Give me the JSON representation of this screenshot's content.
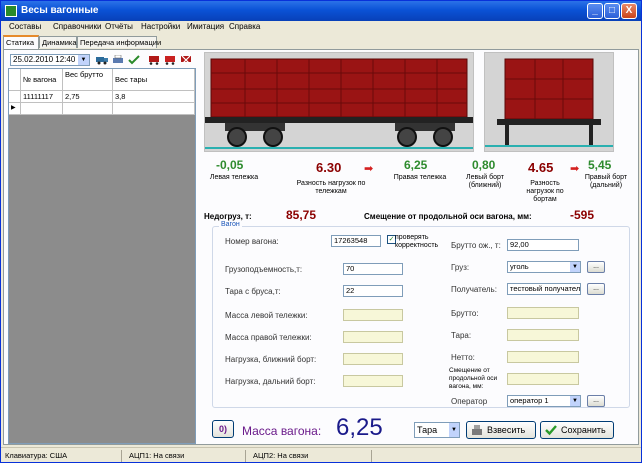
{
  "window": {
    "title": "Весы вагонные",
    "minimize": "_",
    "maximize": "□",
    "close": "X"
  },
  "menu": [
    "Составы",
    "Справочники",
    "Отчёты",
    "Настройки",
    "Имитация",
    "Справка"
  ],
  "tabs": [
    "Статика",
    "Динамика",
    "Передача информации"
  ],
  "left": {
    "date": "25.02.2010 12:40",
    "columns": [
      "№ вагона",
      "Вес брутто",
      "Вес тары"
    ],
    "rows": [
      [
        "11111117",
        "2,75",
        "3,8"
      ]
    ]
  },
  "readings": {
    "left_cart": {
      "value": "-0,05",
      "label": "Левая тележка"
    },
    "cart_diff": {
      "value": "6.30",
      "label": "Разность нагрузок по тележкам"
    },
    "right_cart": {
      "value": "6,25",
      "label": "Правая тележка"
    },
    "left_side": {
      "value": "0,80",
      "label": "Левый борт (ближний)"
    },
    "side_diff": {
      "value": "4.65",
      "label": "Разность нагрузок по бортам"
    },
    "right_side": {
      "value": "5,45",
      "label": "Правый борт (дальний)"
    },
    "underload_label": "Недогруз, т:",
    "underload_value": "85,75",
    "offset_label": "Смещение от продольной оси вагона, мм:",
    "offset_value": "-595"
  },
  "form": {
    "group_title": "Вагон",
    "wagon_number_label": "Номер вагона:",
    "wagon_number": "17263548",
    "check_label": "проверять корректность",
    "check_mark": "✓",
    "capacity_label": "Грузоподъемность,т:",
    "capacity": "70",
    "tare_label": "Тара с бруса,т:",
    "tare": "22",
    "left_cart_mass_label": "Масса левой тележки:",
    "right_cart_mass_label": "Масса правой тележки:",
    "near_side_label": "Нагрузка, ближний борт:",
    "far_side_label": "Нагрузка, дальний борт:",
    "gross_exp_label": "Брутто ож., т:",
    "gross_exp": "92,00",
    "cargo_label": "Груз:",
    "cargo": "уголь",
    "receiver_label": "Получатель:",
    "receiver": "тестовый получатель",
    "gross_label": "Брутто:",
    "tara_label": "Тара:",
    "net_label": "Нетто:",
    "offset_label": "Смещение от продольной оси вагона, мм:",
    "operator_label": "Оператор",
    "operator": "оператор 1",
    "ellipsis": "..."
  },
  "bottom": {
    "mass_label": "Масса вагона:",
    "mass_value": "6,25",
    "mode": "Тара",
    "weigh_button": "Взвесить",
    "save_button": "Сохранить",
    "side_button": "0)"
  },
  "status": {
    "keyboard": "Клавиатура: США",
    "adc1": "АЦП1: На связи",
    "adc2": "АЦП2: На связи"
  },
  "colors": {
    "wagon": "#8b1010",
    "accent_green": "#2e8b2e",
    "accent_red": "#8b0000",
    "mass_purple": "#6a1a8a"
  }
}
